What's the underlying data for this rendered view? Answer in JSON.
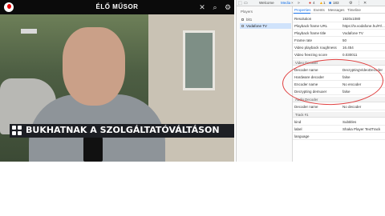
{
  "player": {
    "title": "ÉLŐ MŰSOR",
    "caption": "BUKHATNAK A SZOLGÁLTATÓVÁLTÁSON"
  },
  "devtools": {
    "tabs": [
      "Welcome",
      "Media",
      "4",
      "1",
      "183"
    ],
    "players_header": "Players",
    "players": [
      "blt1",
      "Vodafone TV"
    ],
    "prop_tabs": [
      "Properties",
      "Events",
      "Messages",
      "Timeline"
    ],
    "properties": [
      {
        "k": "Resolution",
        "v": "1920x1080"
      },
      {
        "k": "Playback frame URL",
        "v": "https://tv.vodafone.hu/#!/..."
      },
      {
        "k": "Playback frame title",
        "v": "Vodafone TV"
      },
      {
        "k": "Frame rate",
        "v": "50"
      },
      {
        "k": "Video playback roughness",
        "v": "16.454"
      },
      {
        "k": "Video freezing score",
        "v": "0.030011"
      }
    ],
    "video_decoder_header": "Video Decoder",
    "video_decoder": [
      {
        "k": "Decoder name",
        "v": "DecryptingVideoDecoder"
      },
      {
        "k": "Hardware decoder",
        "v": "false"
      },
      {
        "k": "Encoder name",
        "v": "No encoder"
      },
      {
        "k": "Decrypting demuxer",
        "v": "false"
      }
    ],
    "audio_decoder_header": "Audio Decoder",
    "audio_decoder": [
      {
        "k": "Decoder name",
        "v": "No decoder"
      }
    ],
    "track_header": "Track #1",
    "track": [
      {
        "k": "kind",
        "v": "Subtitles"
      },
      {
        "k": "label",
        "v": "Shaka Player TextTrack"
      },
      {
        "k": "language",
        "v": ""
      }
    ]
  },
  "colors": {
    "accent": "#1a73e8",
    "annotation": "#e04040",
    "caption_bg": "#1d1f24"
  }
}
